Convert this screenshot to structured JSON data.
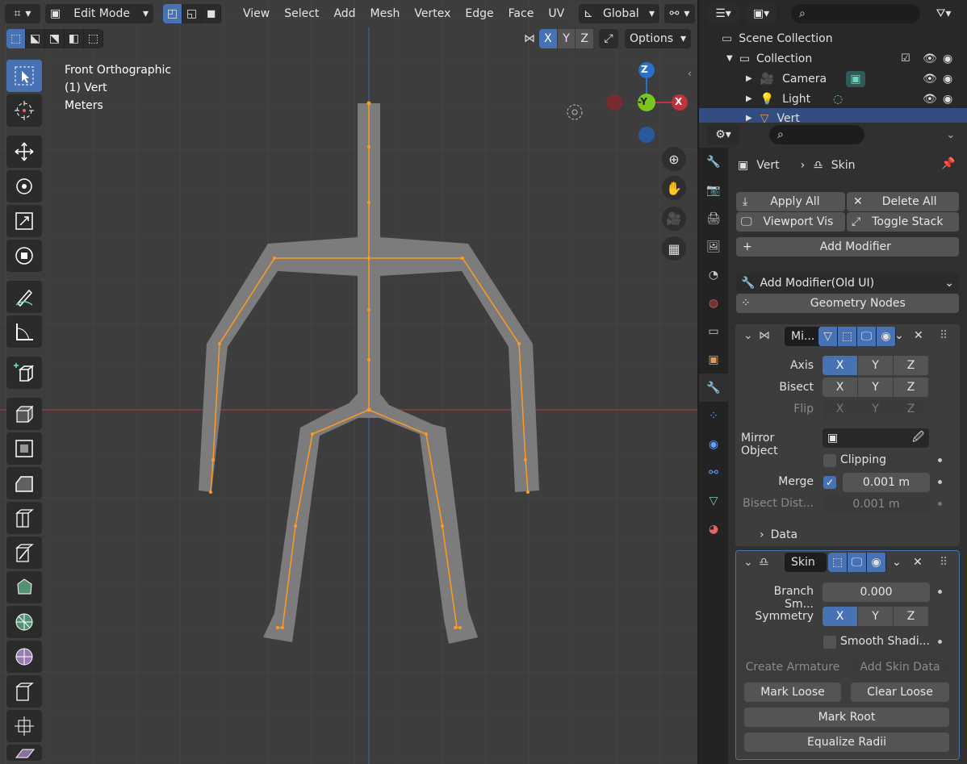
{
  "header": {
    "mode": "Edit Mode",
    "menus": [
      "View",
      "Select",
      "Add",
      "Mesh",
      "Vertex",
      "Edge",
      "Face",
      "UV"
    ],
    "transform_orientation": "Global",
    "mirror_axes": [
      "X",
      "Y",
      "Z"
    ],
    "options_label": "Options"
  },
  "viewport": {
    "view_name": "Front Orthographic",
    "object_info": "(1) Vert",
    "units": "Meters",
    "gizmo": {
      "z": "Z",
      "y": "-Y",
      "x": "X"
    }
  },
  "outliner": {
    "scene_collection": "Scene Collection",
    "collection": "Collection",
    "items": [
      "Camera",
      "Light",
      "Vert"
    ]
  },
  "properties": {
    "breadcrumb_object": "Vert",
    "breadcrumb_modifier": "Skin",
    "apply_all": "Apply All",
    "delete_all": "Delete All",
    "viewport_vis": "Viewport Vis",
    "toggle_stack": "Toggle Stack",
    "add_modifier": "Add Modifier",
    "add_modifier_old": "Add Modifier(Old UI)",
    "geometry_nodes": "Geometry Nodes",
    "mirror": {
      "name": "Mi...",
      "axis_label": "Axis",
      "bisect_label": "Bisect",
      "flip_label": "Flip",
      "axes": [
        "X",
        "Y",
        "Z"
      ],
      "mirror_object_label": "Mirror Object",
      "clipping_label": "Clipping",
      "merge_label": "Merge",
      "merge_value": "0.001 m",
      "bisect_dist_label": "Bisect Dist...",
      "bisect_dist_value": "0.001 m",
      "data_label": "Data"
    },
    "skin": {
      "name": "Skin",
      "branch_label": "Branch Sm...",
      "branch_value": "0.000",
      "symmetry_label": "Symmetry",
      "axes": [
        "X",
        "Y",
        "Z"
      ],
      "smooth_label": "Smooth Shadi...",
      "create_armature": "Create Armature",
      "add_skin_data": "Add Skin Data",
      "mark_loose": "Mark Loose",
      "clear_loose": "Clear Loose",
      "mark_root": "Mark Root",
      "equalize_radii": "Equalize Radii"
    }
  },
  "colors": {
    "accent": "#4772b3",
    "edge": "#ff9a1f",
    "x_axis": "#c0323c",
    "z_axis": "#2a70c9",
    "y_axis": "#7ac520"
  }
}
